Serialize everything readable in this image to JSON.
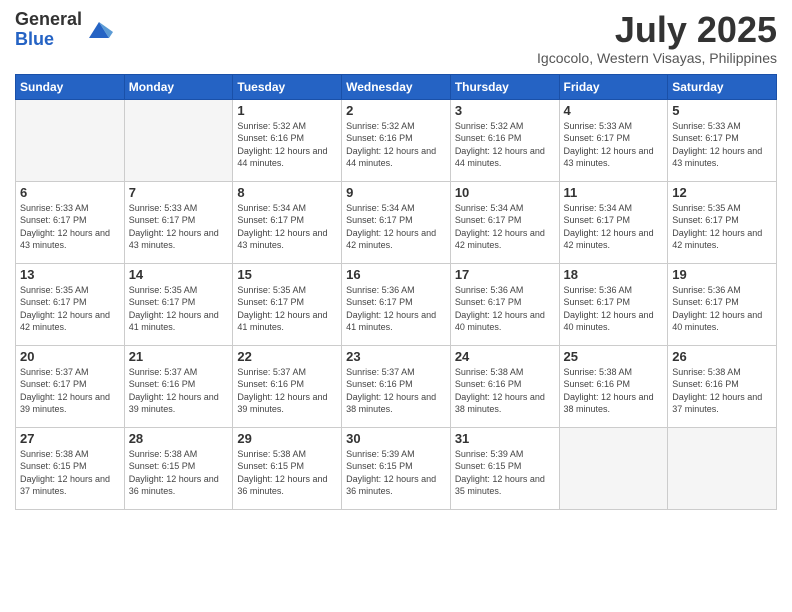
{
  "logo": {
    "general": "General",
    "blue": "Blue"
  },
  "header": {
    "month": "July 2025",
    "location": "Igcocolo, Western Visayas, Philippines"
  },
  "days_of_week": [
    "Sunday",
    "Monday",
    "Tuesday",
    "Wednesday",
    "Thursday",
    "Friday",
    "Saturday"
  ],
  "weeks": [
    [
      {
        "day": "",
        "info": ""
      },
      {
        "day": "",
        "info": ""
      },
      {
        "day": "1",
        "info": "Sunrise: 5:32 AM\nSunset: 6:16 PM\nDaylight: 12 hours and 44 minutes."
      },
      {
        "day": "2",
        "info": "Sunrise: 5:32 AM\nSunset: 6:16 PM\nDaylight: 12 hours and 44 minutes."
      },
      {
        "day": "3",
        "info": "Sunrise: 5:32 AM\nSunset: 6:16 PM\nDaylight: 12 hours and 44 minutes."
      },
      {
        "day": "4",
        "info": "Sunrise: 5:33 AM\nSunset: 6:17 PM\nDaylight: 12 hours and 43 minutes."
      },
      {
        "day": "5",
        "info": "Sunrise: 5:33 AM\nSunset: 6:17 PM\nDaylight: 12 hours and 43 minutes."
      }
    ],
    [
      {
        "day": "6",
        "info": "Sunrise: 5:33 AM\nSunset: 6:17 PM\nDaylight: 12 hours and 43 minutes."
      },
      {
        "day": "7",
        "info": "Sunrise: 5:33 AM\nSunset: 6:17 PM\nDaylight: 12 hours and 43 minutes."
      },
      {
        "day": "8",
        "info": "Sunrise: 5:34 AM\nSunset: 6:17 PM\nDaylight: 12 hours and 43 minutes."
      },
      {
        "day": "9",
        "info": "Sunrise: 5:34 AM\nSunset: 6:17 PM\nDaylight: 12 hours and 42 minutes."
      },
      {
        "day": "10",
        "info": "Sunrise: 5:34 AM\nSunset: 6:17 PM\nDaylight: 12 hours and 42 minutes."
      },
      {
        "day": "11",
        "info": "Sunrise: 5:34 AM\nSunset: 6:17 PM\nDaylight: 12 hours and 42 minutes."
      },
      {
        "day": "12",
        "info": "Sunrise: 5:35 AM\nSunset: 6:17 PM\nDaylight: 12 hours and 42 minutes."
      }
    ],
    [
      {
        "day": "13",
        "info": "Sunrise: 5:35 AM\nSunset: 6:17 PM\nDaylight: 12 hours and 42 minutes."
      },
      {
        "day": "14",
        "info": "Sunrise: 5:35 AM\nSunset: 6:17 PM\nDaylight: 12 hours and 41 minutes."
      },
      {
        "day": "15",
        "info": "Sunrise: 5:35 AM\nSunset: 6:17 PM\nDaylight: 12 hours and 41 minutes."
      },
      {
        "day": "16",
        "info": "Sunrise: 5:36 AM\nSunset: 6:17 PM\nDaylight: 12 hours and 41 minutes."
      },
      {
        "day": "17",
        "info": "Sunrise: 5:36 AM\nSunset: 6:17 PM\nDaylight: 12 hours and 40 minutes."
      },
      {
        "day": "18",
        "info": "Sunrise: 5:36 AM\nSunset: 6:17 PM\nDaylight: 12 hours and 40 minutes."
      },
      {
        "day": "19",
        "info": "Sunrise: 5:36 AM\nSunset: 6:17 PM\nDaylight: 12 hours and 40 minutes."
      }
    ],
    [
      {
        "day": "20",
        "info": "Sunrise: 5:37 AM\nSunset: 6:17 PM\nDaylight: 12 hours and 39 minutes."
      },
      {
        "day": "21",
        "info": "Sunrise: 5:37 AM\nSunset: 6:16 PM\nDaylight: 12 hours and 39 minutes."
      },
      {
        "day": "22",
        "info": "Sunrise: 5:37 AM\nSunset: 6:16 PM\nDaylight: 12 hours and 39 minutes."
      },
      {
        "day": "23",
        "info": "Sunrise: 5:37 AM\nSunset: 6:16 PM\nDaylight: 12 hours and 38 minutes."
      },
      {
        "day": "24",
        "info": "Sunrise: 5:38 AM\nSunset: 6:16 PM\nDaylight: 12 hours and 38 minutes."
      },
      {
        "day": "25",
        "info": "Sunrise: 5:38 AM\nSunset: 6:16 PM\nDaylight: 12 hours and 38 minutes."
      },
      {
        "day": "26",
        "info": "Sunrise: 5:38 AM\nSunset: 6:16 PM\nDaylight: 12 hours and 37 minutes."
      }
    ],
    [
      {
        "day": "27",
        "info": "Sunrise: 5:38 AM\nSunset: 6:15 PM\nDaylight: 12 hours and 37 minutes."
      },
      {
        "day": "28",
        "info": "Sunrise: 5:38 AM\nSunset: 6:15 PM\nDaylight: 12 hours and 36 minutes."
      },
      {
        "day": "29",
        "info": "Sunrise: 5:38 AM\nSunset: 6:15 PM\nDaylight: 12 hours and 36 minutes."
      },
      {
        "day": "30",
        "info": "Sunrise: 5:39 AM\nSunset: 6:15 PM\nDaylight: 12 hours and 36 minutes."
      },
      {
        "day": "31",
        "info": "Sunrise: 5:39 AM\nSunset: 6:15 PM\nDaylight: 12 hours and 35 minutes."
      },
      {
        "day": "",
        "info": ""
      },
      {
        "day": "",
        "info": ""
      }
    ]
  ]
}
